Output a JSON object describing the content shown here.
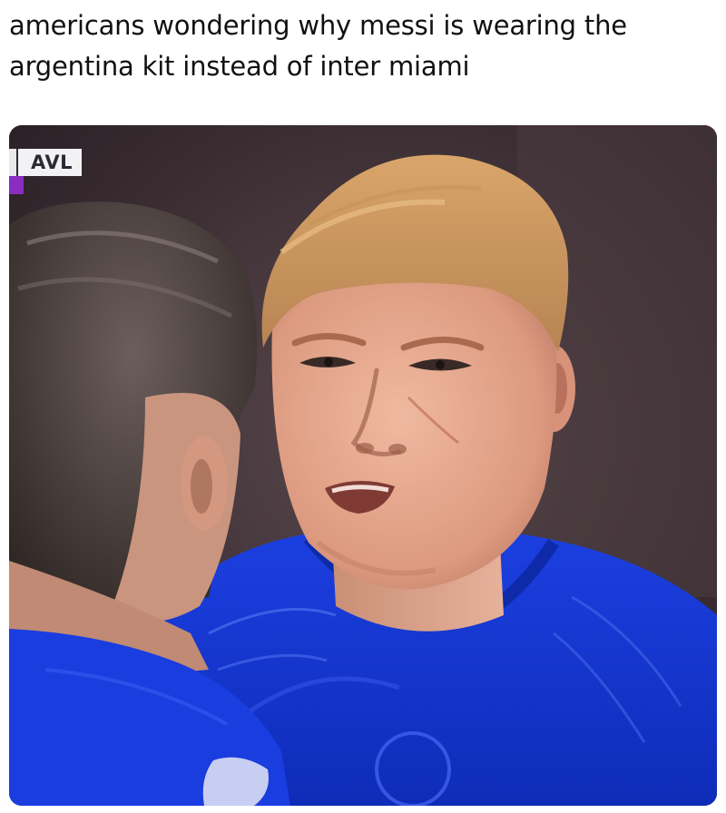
{
  "caption": {
    "line1": "americans wondering why messi is wearing the",
    "line2": "argentina kit instead of inter miami"
  },
  "broadcast": {
    "team_abbrev": "AVL",
    "accent_color": "#8a2bc2"
  },
  "photo": {
    "kit_color": "#1637d6",
    "background_color": "#3a2f33"
  }
}
